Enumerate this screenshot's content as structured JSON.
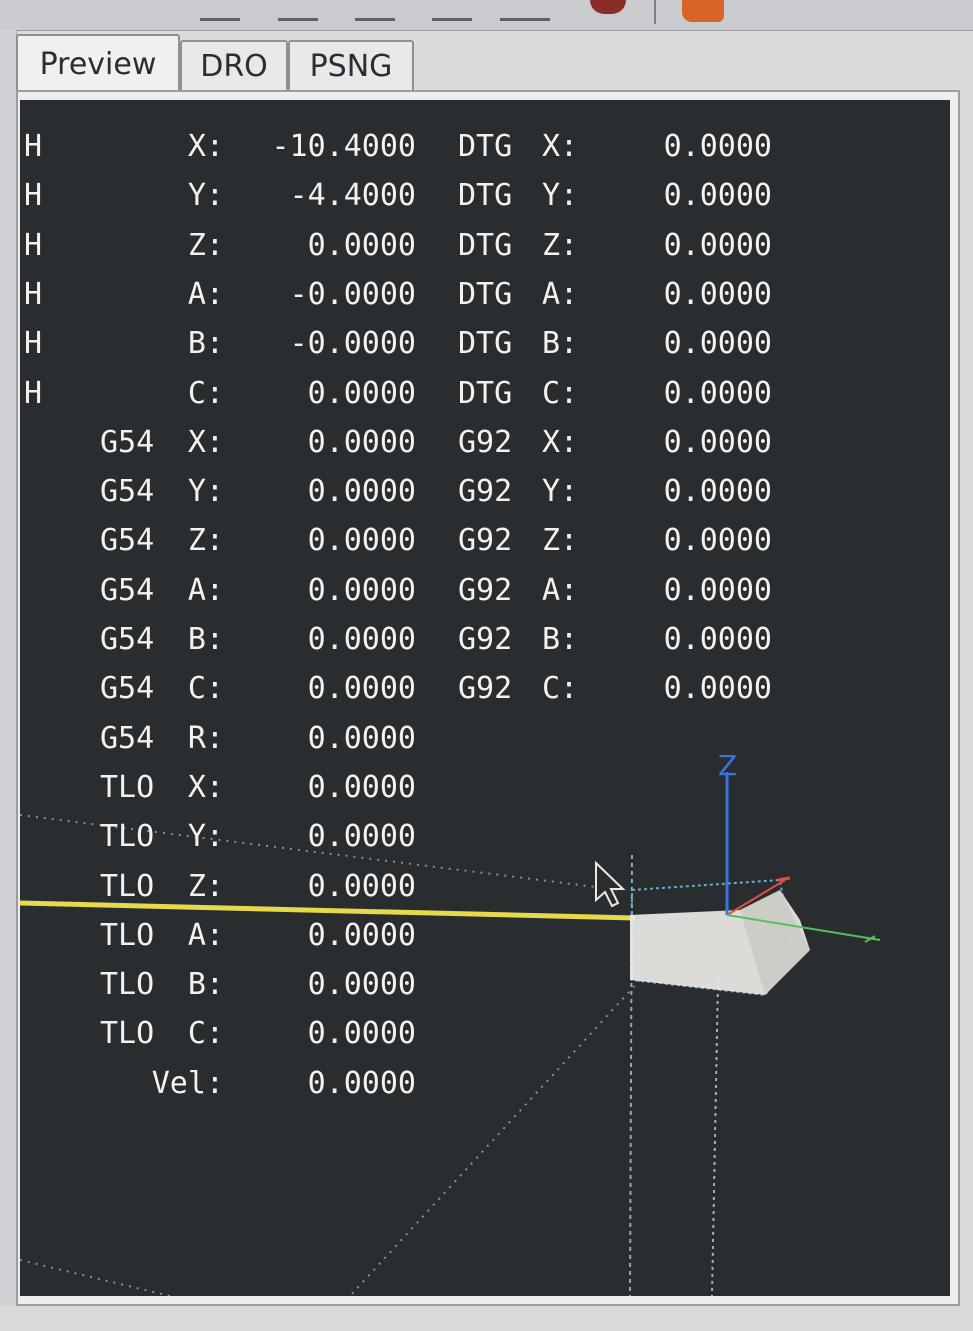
{
  "tabs": [
    "Preview",
    "DRO",
    "PSNG"
  ],
  "active_tab": "Preview",
  "homed_flags": [
    "H",
    "H",
    "H",
    "H",
    "H",
    "H"
  ],
  "rows": [
    {
      "prefix": "",
      "axis": "X:",
      "value": "-10.4000",
      "rprefix": "DTG",
      "raxis": "X:",
      "rvalue": "0.0000"
    },
    {
      "prefix": "",
      "axis": "Y:",
      "value": "-4.4000",
      "rprefix": "DTG",
      "raxis": "Y:",
      "rvalue": "0.0000"
    },
    {
      "prefix": "",
      "axis": "Z:",
      "value": "0.0000",
      "rprefix": "DTG",
      "raxis": "Z:",
      "rvalue": "0.0000"
    },
    {
      "prefix": "",
      "axis": "A:",
      "value": "-0.0000",
      "rprefix": "DTG",
      "raxis": "A:",
      "rvalue": "0.0000"
    },
    {
      "prefix": "",
      "axis": "B:",
      "value": "-0.0000",
      "rprefix": "DTG",
      "raxis": "B:",
      "rvalue": "0.0000"
    },
    {
      "prefix": "",
      "axis": "C:",
      "value": "0.0000",
      "rprefix": "DTG",
      "raxis": "C:",
      "rvalue": "0.0000"
    },
    {
      "prefix": "G54",
      "axis": "X:",
      "value": "0.0000",
      "rprefix": "G92",
      "raxis": "X:",
      "rvalue": "0.0000"
    },
    {
      "prefix": "G54",
      "axis": "Y:",
      "value": "0.0000",
      "rprefix": "G92",
      "raxis": "Y:",
      "rvalue": "0.0000"
    },
    {
      "prefix": "G54",
      "axis": "Z:",
      "value": "0.0000",
      "rprefix": "G92",
      "raxis": "Z:",
      "rvalue": "0.0000"
    },
    {
      "prefix": "G54",
      "axis": "A:",
      "value": "0.0000",
      "rprefix": "G92",
      "raxis": "A:",
      "rvalue": "0.0000"
    },
    {
      "prefix": "G54",
      "axis": "B:",
      "value": "0.0000",
      "rprefix": "G92",
      "raxis": "B:",
      "rvalue": "0.0000"
    },
    {
      "prefix": "G54",
      "axis": "C:",
      "value": "0.0000",
      "rprefix": "G92",
      "raxis": "C:",
      "rvalue": "0.0000"
    },
    {
      "prefix": "G54",
      "axis": "R:",
      "value": "0.0000",
      "rprefix": "",
      "raxis": "",
      "rvalue": ""
    },
    {
      "prefix": "TLO",
      "axis": "X:",
      "value": "0.0000",
      "rprefix": "",
      "raxis": "",
      "rvalue": ""
    },
    {
      "prefix": "TLO",
      "axis": "Y:",
      "value": "0.0000",
      "rprefix": "",
      "raxis": "",
      "rvalue": ""
    },
    {
      "prefix": "TLO",
      "axis": "Z:",
      "value": "0.0000",
      "rprefix": "",
      "raxis": "",
      "rvalue": ""
    },
    {
      "prefix": "TLO",
      "axis": "A:",
      "value": "0.0000",
      "rprefix": "",
      "raxis": "",
      "rvalue": ""
    },
    {
      "prefix": "TLO",
      "axis": "B:",
      "value": "0.0000",
      "rprefix": "",
      "raxis": "",
      "rvalue": ""
    },
    {
      "prefix": "TLO",
      "axis": "C:",
      "value": "0.0000",
      "rprefix": "",
      "raxis": "",
      "rvalue": ""
    },
    {
      "prefix": "",
      "axis": "Vel:",
      "value": "0.0000",
      "rprefix": "",
      "raxis": "",
      "rvalue": ""
    }
  ],
  "axis_label_z": "Z",
  "colors": {
    "background": "#2a2d2f",
    "text": "#f2f2f2",
    "toolpath": "#e6d94a",
    "z_axis": "#3a74e0",
    "x_axis": "#e05040",
    "y_axis": "#50c060",
    "machine_limits": "#6fa8c8",
    "part": "#f0f0ec"
  }
}
